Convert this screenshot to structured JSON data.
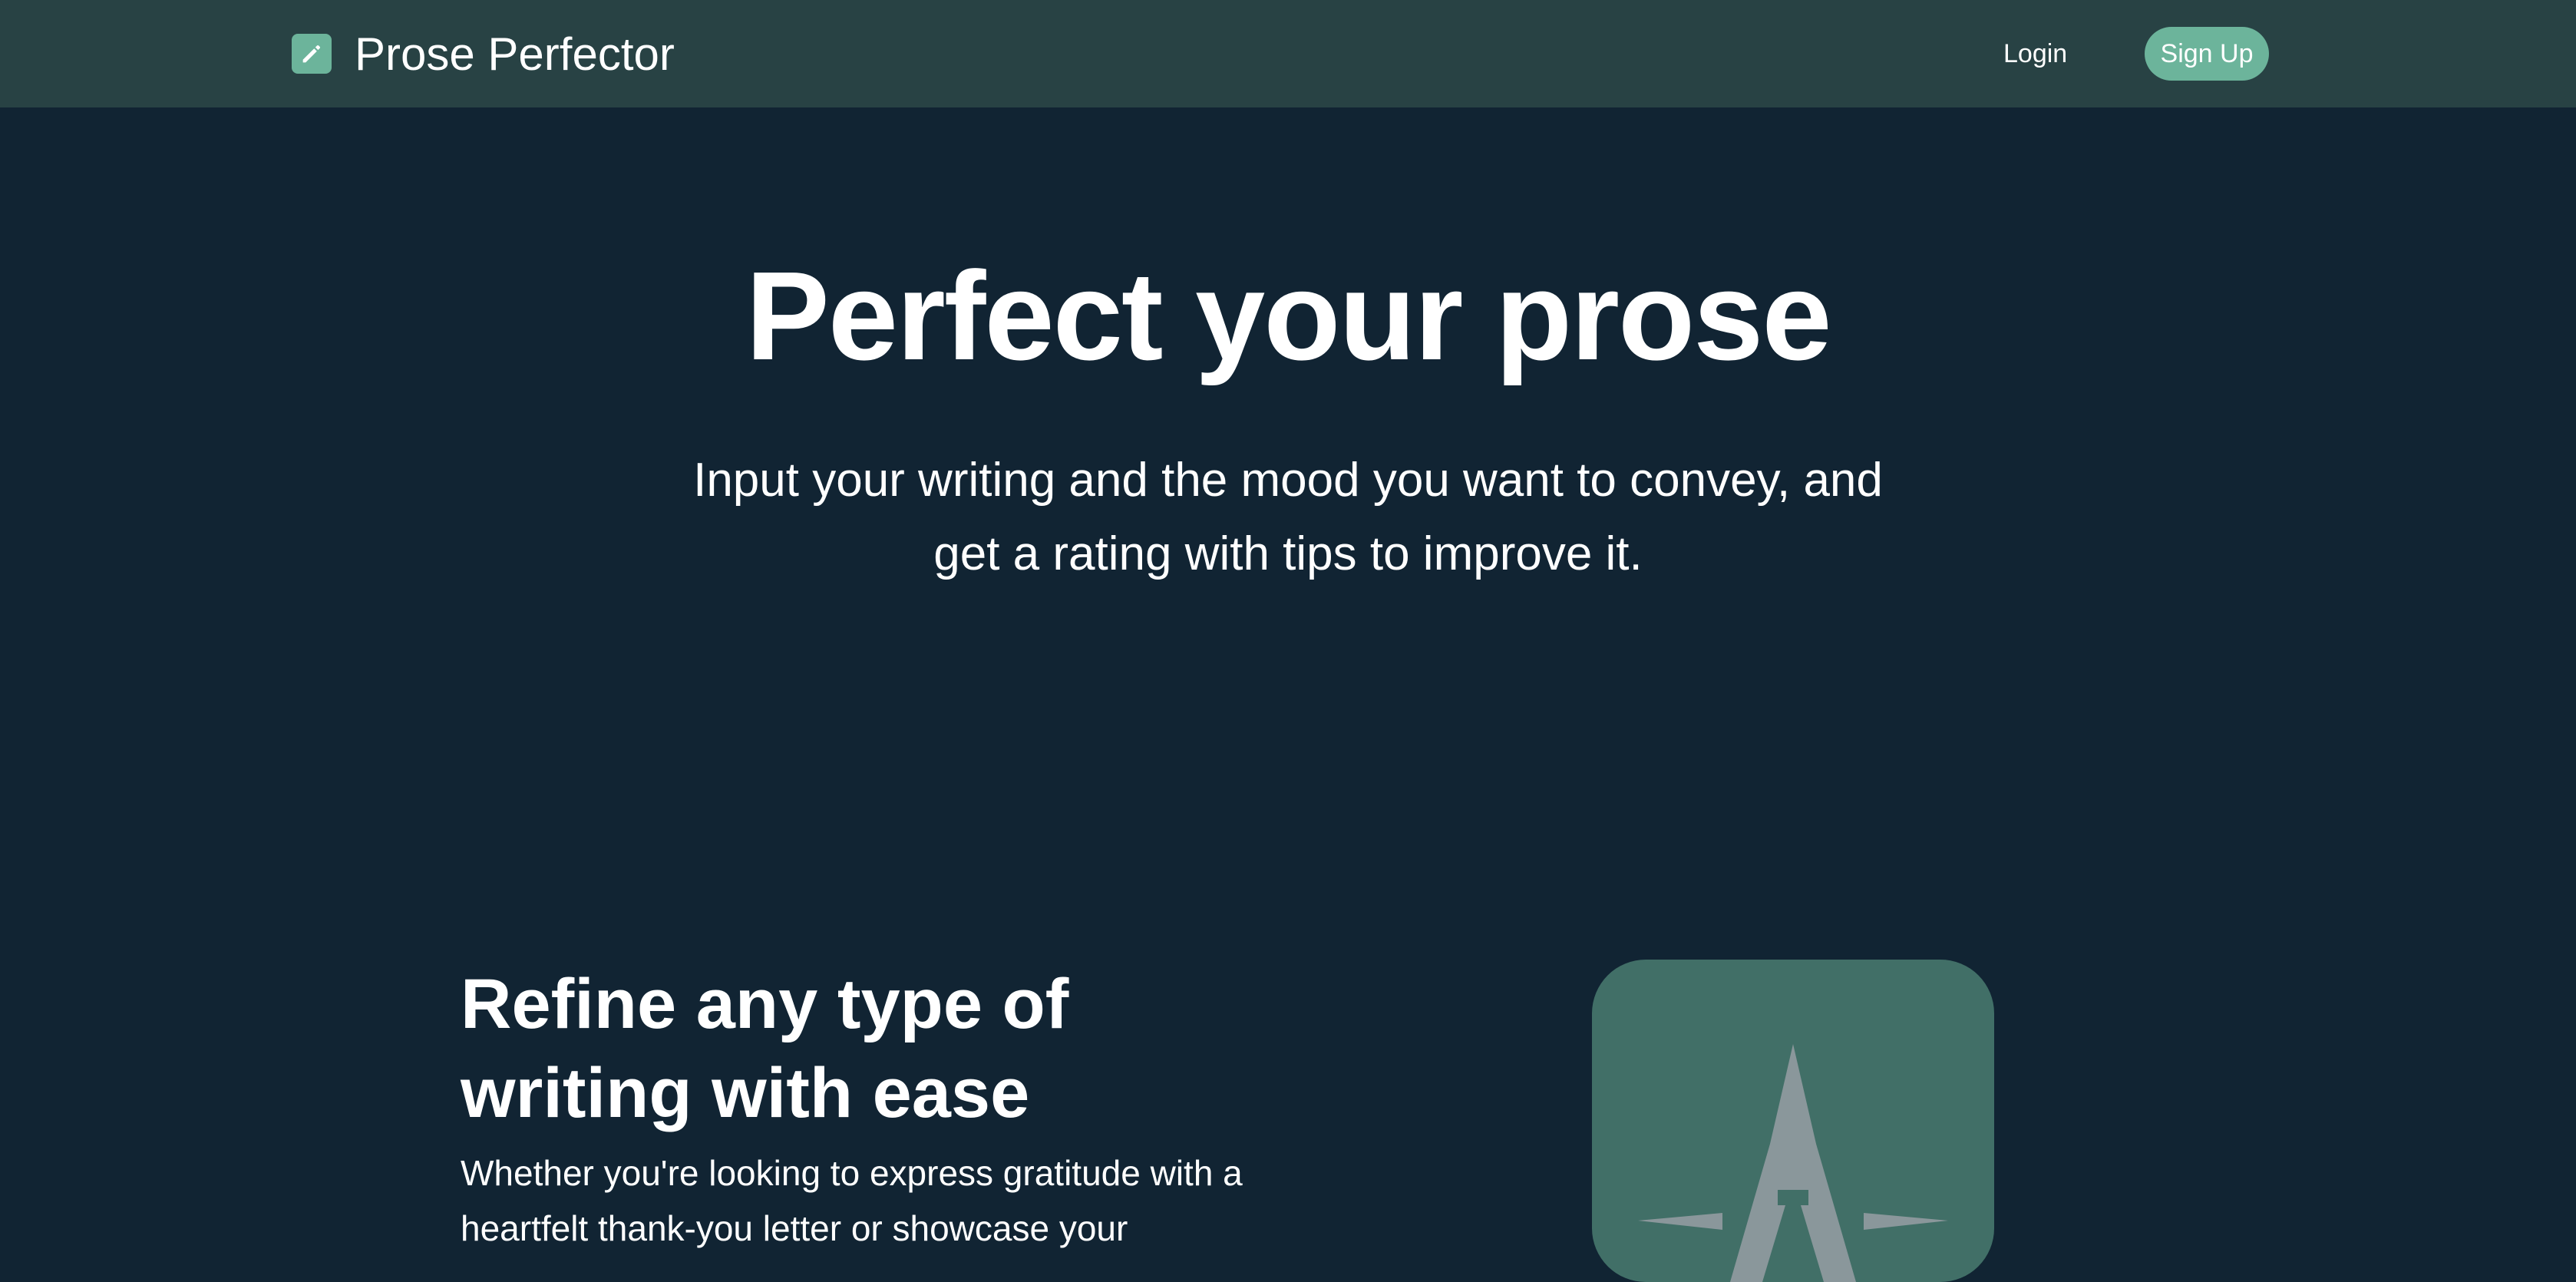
{
  "navbar": {
    "brand_name": "Prose Perfector",
    "brand_icon": "pencil-icon",
    "login_label": "Login",
    "signup_label": "Sign Up"
  },
  "hero": {
    "title": "Perfect your prose",
    "subtitle": "Input your writing and the mood you want to convey, and get a rating with tips to improve it."
  },
  "feature": {
    "heading": "Refine any type of writing with ease",
    "text": "Whether you're looking to express gratitude with a heartfelt thank-you letter or showcase your",
    "illustration_icon": "letter-a-compass-icon"
  },
  "colors": {
    "background": "#112433",
    "navbar": "#284244",
    "accent": "#6cb49b",
    "card": "#416f67",
    "card_glyph": "#8a979b"
  }
}
